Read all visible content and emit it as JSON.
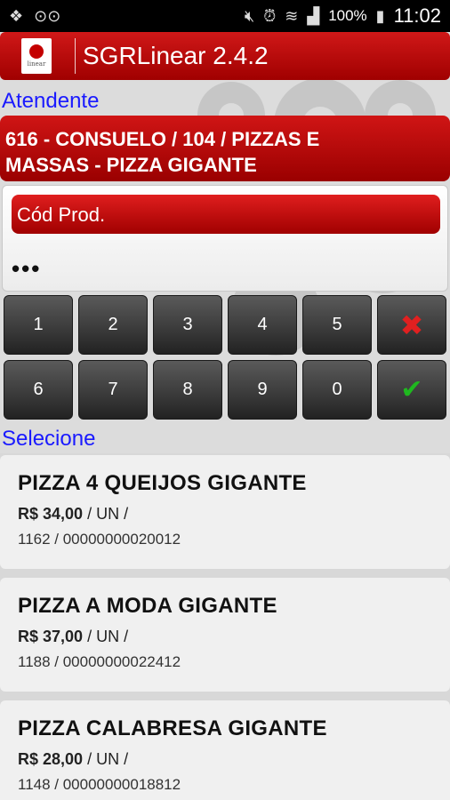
{
  "status_bar": {
    "battery": "100%",
    "time": "11:02"
  },
  "app": {
    "title": "SGRLinear 2.4.2",
    "logo_text": "linear"
  },
  "atendente": {
    "label": "Atendente",
    "line1": "616 - CONSUELO / 104 / PIZZAS E",
    "line2": "MASSAS - PIZZA GIGANTE"
  },
  "code_input": {
    "label": "Cód Prod.",
    "value": "•••"
  },
  "keypad": {
    "row1": [
      "1",
      "2",
      "3",
      "4",
      "5"
    ],
    "row2": [
      "6",
      "7",
      "8",
      "9",
      "0"
    ],
    "cancel_icon": "✖",
    "confirm_icon": "✔"
  },
  "list": {
    "label": "Selecione",
    "items": [
      {
        "name": "PIZZA 4 QUEIJOS GIGANTE",
        "price": "R$ 34,00",
        "unit": "/ UN /",
        "code": "1162 / 00000000020012"
      },
      {
        "name": "PIZZA A MODA GIGANTE",
        "price": "R$ 37,00",
        "unit": "/ UN /",
        "code": "1188 / 00000000022412"
      },
      {
        "name": "PIZZA CALABRESA GIGANTE",
        "price": "R$ 28,00",
        "unit": "/ UN /",
        "code": "1148 / 00000000018812"
      }
    ]
  },
  "colors": {
    "accent_red": "#c00000",
    "label_blue": "#1a1aff",
    "confirm_green": "#1fb81f"
  }
}
